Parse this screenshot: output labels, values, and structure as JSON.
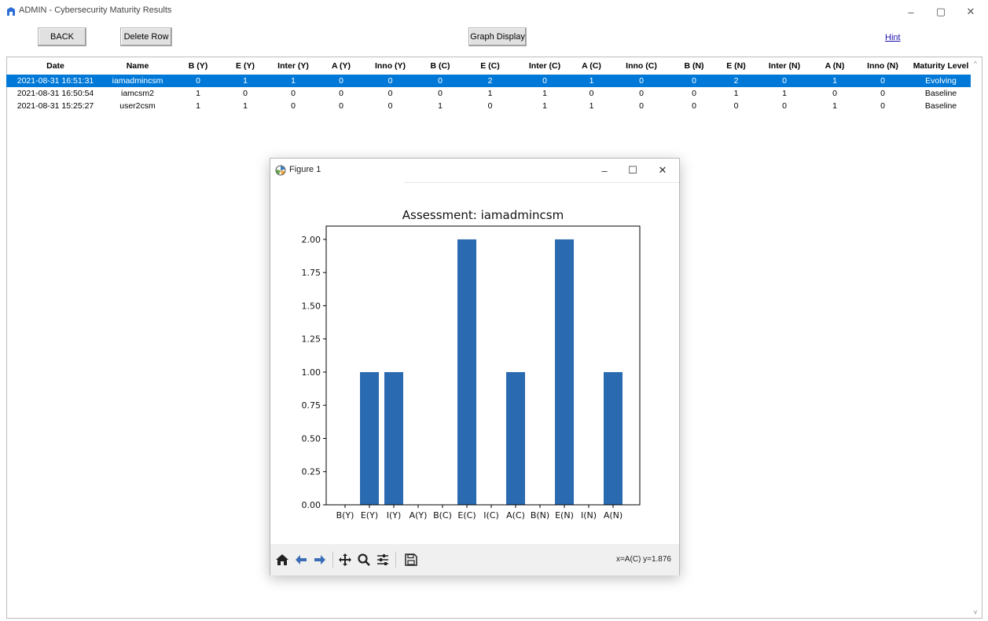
{
  "window": {
    "title": "ADMIN - Cybersecurity Maturity Results",
    "minimize": "–",
    "maximize": "▢",
    "close": "✕"
  },
  "toolbar": {
    "back_label": "BACK",
    "delete_label": "Delete Row",
    "graph_label": "Graph Display",
    "hint_label": "Hint"
  },
  "table": {
    "columns": [
      "Date",
      "Name",
      "B (Y)",
      "E (Y)",
      "Inter (Y)",
      "A (Y)",
      "Inno (Y)",
      "B (C)",
      "E (C)",
      "Inter (C)",
      "A (C)",
      "Inno (C)",
      "B (N)",
      "E (N)",
      "Inter (N)",
      "A (N)",
      "Inno (N)",
      "Maturity Level"
    ],
    "rows": [
      [
        "2021-08-31 16:51:31",
        "iamadmincsm",
        "0",
        "1",
        "1",
        "0",
        "0",
        "0",
        "2",
        "0",
        "1",
        "0",
        "0",
        "2",
        "0",
        "1",
        "0",
        "Evolving"
      ],
      [
        "2021-08-31 16:50:54",
        "iamcsm2",
        "1",
        "0",
        "0",
        "0",
        "0",
        "0",
        "1",
        "1",
        "0",
        "0",
        "0",
        "1",
        "1",
        "0",
        "0",
        "Baseline"
      ],
      [
        "2021-08-31 15:25:27",
        "user2csm",
        "1",
        "1",
        "0",
        "0",
        "0",
        "1",
        "0",
        "1",
        "1",
        "0",
        "0",
        "0",
        "0",
        "1",
        "0",
        "Baseline"
      ]
    ],
    "selected_row": 0,
    "scroll_up": "^",
    "scroll_down": "v"
  },
  "figure": {
    "title": "Figure 1",
    "minimize": "–",
    "maximize": "☐",
    "close": "✕",
    "coordinate_readout": "x=A(C) y=1.876",
    "toolbar_icons": [
      "home-icon",
      "back-arrow-icon",
      "forward-arrow-icon",
      "pan-icon",
      "zoom-icon",
      "configure-subplots-icon",
      "save-icon"
    ]
  },
  "chart_data": {
    "type": "bar",
    "title": "Assessment: iamadmincsm",
    "categories": [
      "B(Y)",
      "E(Y)",
      "I(Y)",
      "A(Y)",
      "B(C)",
      "E(C)",
      "I(C)",
      "A(C)",
      "B(N)",
      "E(N)",
      "I(N)",
      "A(N)"
    ],
    "values": [
      0,
      1,
      1,
      0,
      0,
      2,
      0,
      1,
      0,
      2,
      0,
      1
    ],
    "ylim": [
      0,
      2.1
    ],
    "yticks": [
      "0.00",
      "0.25",
      "0.50",
      "0.75",
      "1.00",
      "1.25",
      "1.50",
      "1.75",
      "2.00"
    ],
    "color": "#2a6ab1",
    "xlabel": "",
    "ylabel": "",
    "grid": false
  },
  "colors": {
    "selection": "#0078d7",
    "bar": "#2a6ab1",
    "hint_link": "#1a0dab"
  }
}
